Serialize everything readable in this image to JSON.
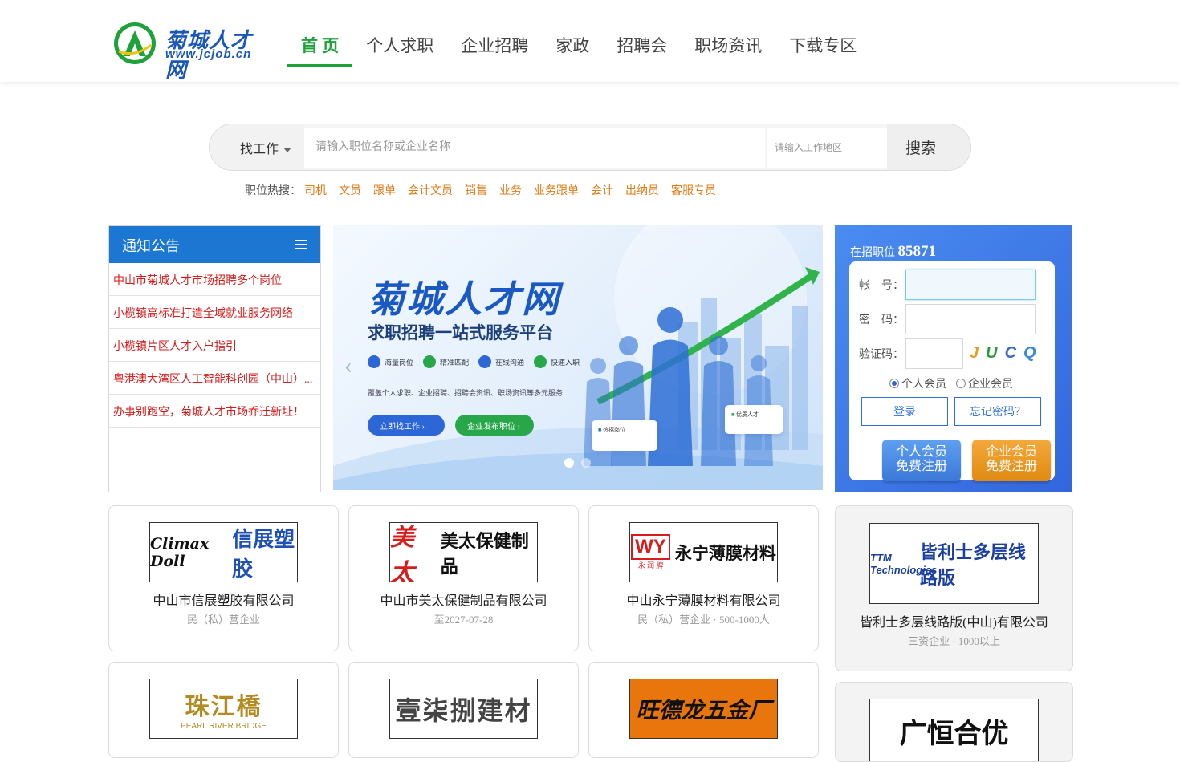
{
  "site": {
    "logo_name": "菊城人才网",
    "logo_url": "www.jcjob.cn",
    "brand_color": "#1fa23a"
  },
  "nav": [
    {
      "label": "首 页",
      "active": true
    },
    {
      "label": "个人求职"
    },
    {
      "label": "企业招聘"
    },
    {
      "label": "家政"
    },
    {
      "label": "招聘会"
    },
    {
      "label": "职场资讯"
    },
    {
      "label": "下载专区"
    }
  ],
  "search": {
    "type_label": "找工作",
    "keyword_placeholder": "请输入职位名称或企业名称",
    "area_placeholder": "请输入工作地区",
    "button_label": "搜索"
  },
  "hot_search": {
    "label": "职位热搜：",
    "terms": [
      "司机",
      "文员",
      "跟单",
      "会计文员",
      "销售",
      "业务",
      "业务跟单",
      "会计",
      "出纳员",
      "客服专员"
    ]
  },
  "notices": {
    "title": "通知公告",
    "items": [
      "中山市菊城人才市场招聘多个岗位",
      "小榄镇高标准打造全域就业服务网络",
      "小榄镇片区人才入户指引",
      "粤港澳大湾区人工智能科创园（中山）...",
      "办事别跑空，菊城人才市场乔迁新址！"
    ]
  },
  "banner": {
    "title": "菊城人才网",
    "subtitle": "求职招聘一站式服务平台",
    "features": [
      "海量岗位",
      "精准匹配",
      "在线沟通",
      "快速入职"
    ],
    "description": "覆盖个人求职、企业招聘、招聘会资讯、职场资讯等多元服务",
    "button_find": "立即找工作",
    "button_post": "企业发布职位",
    "card_hot": "热招岗位",
    "card_talent": "优质人才"
  },
  "login": {
    "jobs_label": "在招职位",
    "jobs_count": "85871",
    "account_label": "帐　号：",
    "password_label": "密　码：",
    "captcha_label": "验证码：",
    "captcha_text": "JUCQ",
    "radio_personal": "个人会员",
    "radio_company": "企业会员",
    "login_button": "登录",
    "forgot_button": "忘记密码？",
    "reg_personal_1": "个人会员",
    "reg_personal_2": "免费注册",
    "reg_company_1": "企业会员",
    "reg_company_2": "免费注册"
  },
  "companies": [
    {
      "logo_en": "Climax Doll",
      "logo_cn": "信展塑胶",
      "name": "中山市信展塑胶有限公司",
      "meta": "民（私）营企业"
    },
    {
      "logo_en": "美太",
      "logo_cn": "美太保健制品",
      "name": "中山市美太保健制品有限公司",
      "meta": "至2027-07-28"
    },
    {
      "logo_en": "WY",
      "logo_sub": "永 润 牌",
      "logo_cn": "永宁薄膜材料",
      "name": "中山永宁薄膜材料有限公司",
      "meta": "民（私）营企业 · 500-1000人"
    },
    {
      "logo_en": "TTM Technologies",
      "logo_cn": "皆利士多层线路版",
      "name": "皆利士多层线路版(中山)有限公司",
      "meta": "三资企业 · 1000以上"
    },
    {
      "logo_cn": "珠江橋",
      "logo_en": "PEARL RIVER BRIDGE"
    },
    {
      "logo_cn": "壹柒捌建材"
    },
    {
      "logo_cn": "旺德龙五金厂"
    },
    {
      "logo_cn": "广恒合优"
    }
  ]
}
